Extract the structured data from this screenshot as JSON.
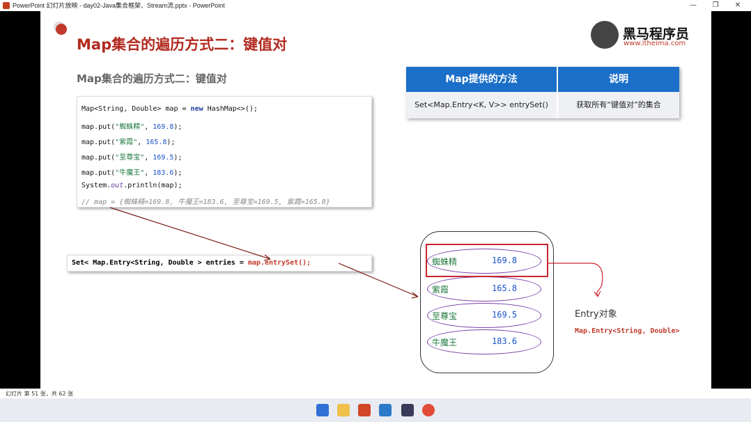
{
  "window": {
    "title": "PowerPoint 幻灯片放映  -  day02-Java集合框架、Stream流.pptx  -  PowerPoint",
    "minimize": "—",
    "restore": "❐",
    "close": "✕"
  },
  "slide": {
    "title": "Map集合的遍历方式二：键值对",
    "subtitle": "Map集合的遍历方式二：键值对",
    "logo": {
      "name": "黑马程序员",
      "url": "www.itheima.com"
    },
    "code": {
      "line1_a": "Map<String, Double> map = ",
      "line1_kw": "new",
      "line1_b": " HashMap<>();",
      "puts": [
        {
          "pre": "map.put(",
          "key": "\"蜘蛛精\"",
          "sep": ", ",
          "val": "169.8",
          "post": ");"
        },
        {
          "pre": "map.put(",
          "key": "\"紫霞\"",
          "sep": ", ",
          "val": "165.8",
          "post": ");"
        },
        {
          "pre": "map.put(",
          "key": "\"至尊宝\"",
          "sep": ", ",
          "val": "169.5",
          "post": ");"
        },
        {
          "pre": "map.put(",
          "key": "\"牛魔王\"",
          "sep": ", ",
          "val": "183.6",
          "post": ");"
        }
      ],
      "print_a": "System.",
      "print_out": "out",
      "print_b": ".println(map);",
      "comment": "// map = {蜘蛛精=169.8, 牛魔王=183.6, 至尊宝=169.5, 紫霞=165.8}"
    },
    "code2": {
      "a": "Set< Map.Entry<String, Double > entries = ",
      "b": "map.entrySet();"
    },
    "table": {
      "headers": [
        "Map提供的方法",
        "说明"
      ],
      "rows": [
        [
          "Set<Map.Entry<K, V>> entrySet()",
          "获取所有“键值对”的集合"
        ]
      ]
    },
    "entries": [
      {
        "key": "蜘蛛精",
        "value": "169.8"
      },
      {
        "key": "紫霞",
        "value": "165.8"
      },
      {
        "key": "至尊宝",
        "value": "169.5"
      },
      {
        "key": "牛魔王",
        "value": "183.6"
      }
    ],
    "entry_label": "Entry对象",
    "entry_type": "Map.Entry<String, Double>"
  },
  "status": {
    "slide_info": "幻灯片 第 51 张，共 62 张"
  },
  "colors": {
    "accent_red": "#c0392b",
    "table_blue": "#1b6fc9"
  }
}
